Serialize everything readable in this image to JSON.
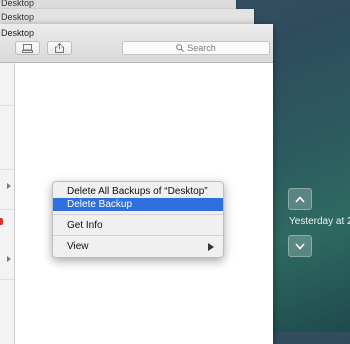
{
  "windows": {
    "back_title_3": "Desktop",
    "back_title_2": "Desktop",
    "main_title": "Desktop"
  },
  "toolbar": {
    "search_placeholder": "Search"
  },
  "context_menu": {
    "items": [
      {
        "label": "Delete All Backups of “Desktop”"
      },
      {
        "label": "Delete Backup",
        "highlighted": true
      },
      {
        "label": "Get Info"
      },
      {
        "label": "View",
        "has_submenu": true
      }
    ]
  },
  "time_machine": {
    "date_label": "Yesterday at 2"
  },
  "colors": {
    "highlight": "#2f6fde",
    "background": "#2e5a62"
  }
}
